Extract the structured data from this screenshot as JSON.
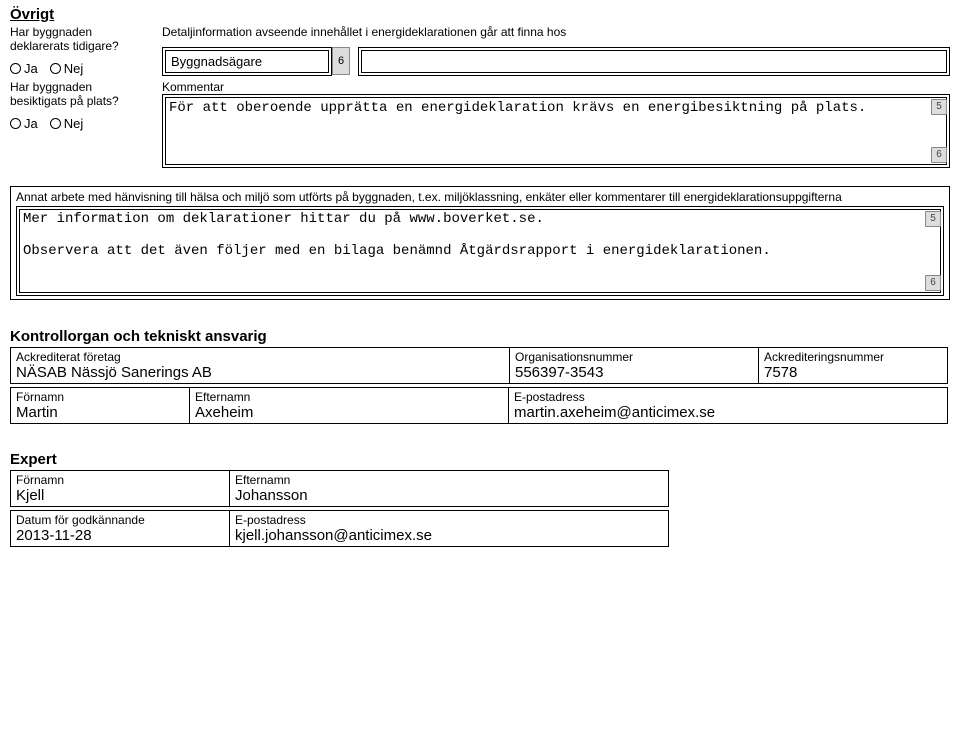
{
  "ovrigt": {
    "title": "Övrigt",
    "q1": "Har byggnaden deklarerats tidigare?",
    "q2": "Har byggnaden besiktigats på plats?",
    "ja": "Ja",
    "nej": "Nej",
    "detalj_label": "Detaljinformation avseende innehållet i energideklarationen går att finna hos",
    "byggnadsagare": "Byggnadsägare",
    "dropdown_num": "6",
    "kommentar_label": "Kommentar",
    "kommentar_text": "För att oberoende upprätta en energideklaration krävs en energibesiktning på plats.",
    "scroll_top": "5",
    "scroll_bottom": "6"
  },
  "annat": {
    "label": "Annat arbete med hänvisning till hälsa och miljö som utförts på byggnaden, t.ex. miljöklassning, enkäter eller kommentarer till energideklarationsuppgifterna",
    "text1": "Mer information om deklarationer hittar du på www.boverket.se.",
    "text2": "Observera att det även följer med en bilaga benämnd Åtgärdsrapport i energideklarationen.",
    "scroll_top": "5",
    "scroll_bottom": "6"
  },
  "kontroll": {
    "title": "Kontrollorgan och tekniskt ansvarig",
    "labels": {
      "foretag": "Ackrediterat företag",
      "orgnr": "Organisationsnummer",
      "acknr": "Ackrediteringsnummer",
      "fornamn": "Förnamn",
      "efternamn": "Efternamn",
      "epost": "E-postadress"
    },
    "foretag": "NÄSAB Nässjö Sanerings AB",
    "orgnr": "556397-3543",
    "acknr": "7578",
    "fornamn": "Martin",
    "efternamn": "Axeheim",
    "epost": "martin.axeheim@anticimex.se"
  },
  "expert": {
    "title": "Expert",
    "labels": {
      "fornamn": "Förnamn",
      "efternamn": "Efternamn",
      "datum": "Datum för godkännande",
      "epost": "E-postadress"
    },
    "fornamn": "Kjell",
    "efternamn": "Johansson",
    "datum": "2013-11-28",
    "epost": "kjell.johansson@anticimex.se"
  }
}
